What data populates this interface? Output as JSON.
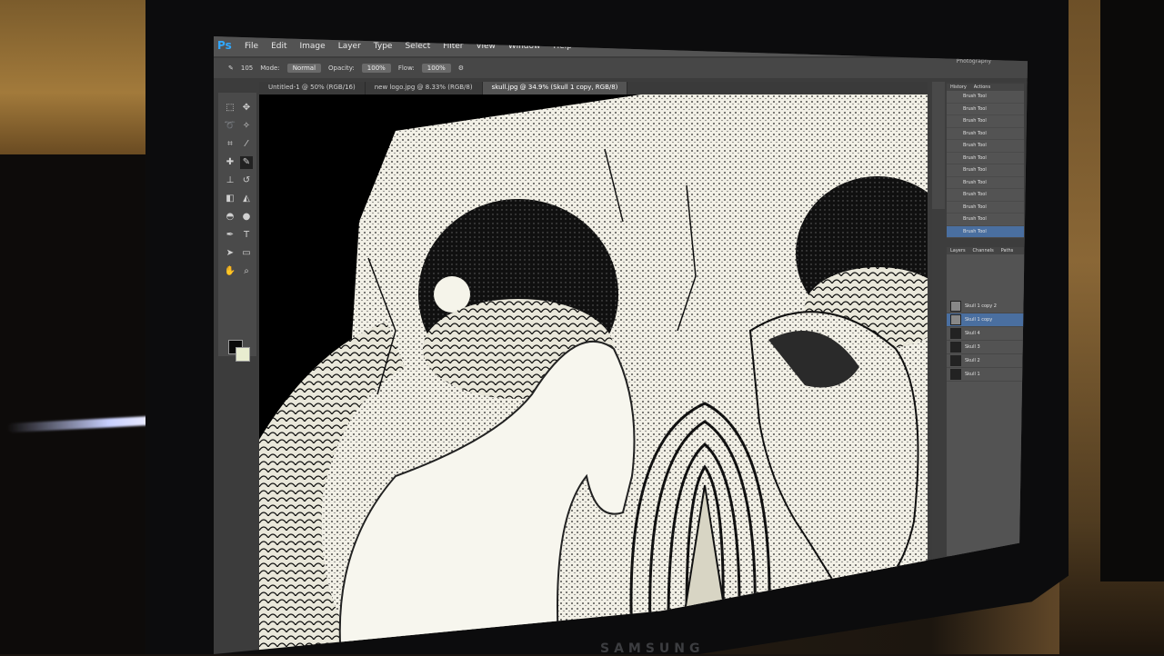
{
  "photo": {
    "monitor_brand": "SAMSUNG"
  },
  "app": {
    "logo": "Ps",
    "menus": [
      "File",
      "Edit",
      "Image",
      "Layer",
      "Type",
      "Select",
      "Filter",
      "View",
      "Window",
      "Help"
    ],
    "workspace": "Photography"
  },
  "options_bar": {
    "mode_label": "Mode:",
    "mode_value": "Normal",
    "opacity_label": "Opacity:",
    "opacity_value": "100%",
    "flow_label": "Flow:",
    "flow_value": "100%",
    "brush_size": "105"
  },
  "documents": {
    "tabs": [
      {
        "label": "Untitled-1 @ 50% (RGB/16)"
      },
      {
        "label": "new logo.jpg @ 8.33% (RGB/8)"
      },
      {
        "label": "skull.jpg @ 34.9% (Skull 1 copy, RGB/8)"
      }
    ]
  },
  "history_panel": {
    "tabs": [
      "History",
      "Actions"
    ],
    "items": [
      "Brush Tool",
      "Brush Tool",
      "Brush Tool",
      "Brush Tool",
      "Brush Tool",
      "Brush Tool",
      "Brush Tool",
      "Brush Tool",
      "Brush Tool",
      "Brush Tool",
      "Brush Tool",
      "Brush Tool"
    ]
  },
  "layers_panel": {
    "tabs": [
      "Layers",
      "Channels",
      "Paths"
    ],
    "layers": [
      "Skull 1 copy 2",
      "Skull 1 copy",
      "Skull 4",
      "Skull 3",
      "Skull 2",
      "Skull 1"
    ]
  },
  "colors": {
    "foreground": "#0a0a0a",
    "background": "#e8ecd0",
    "ui_dark": "#3c3c3c",
    "selection": "#4a6fa0"
  }
}
